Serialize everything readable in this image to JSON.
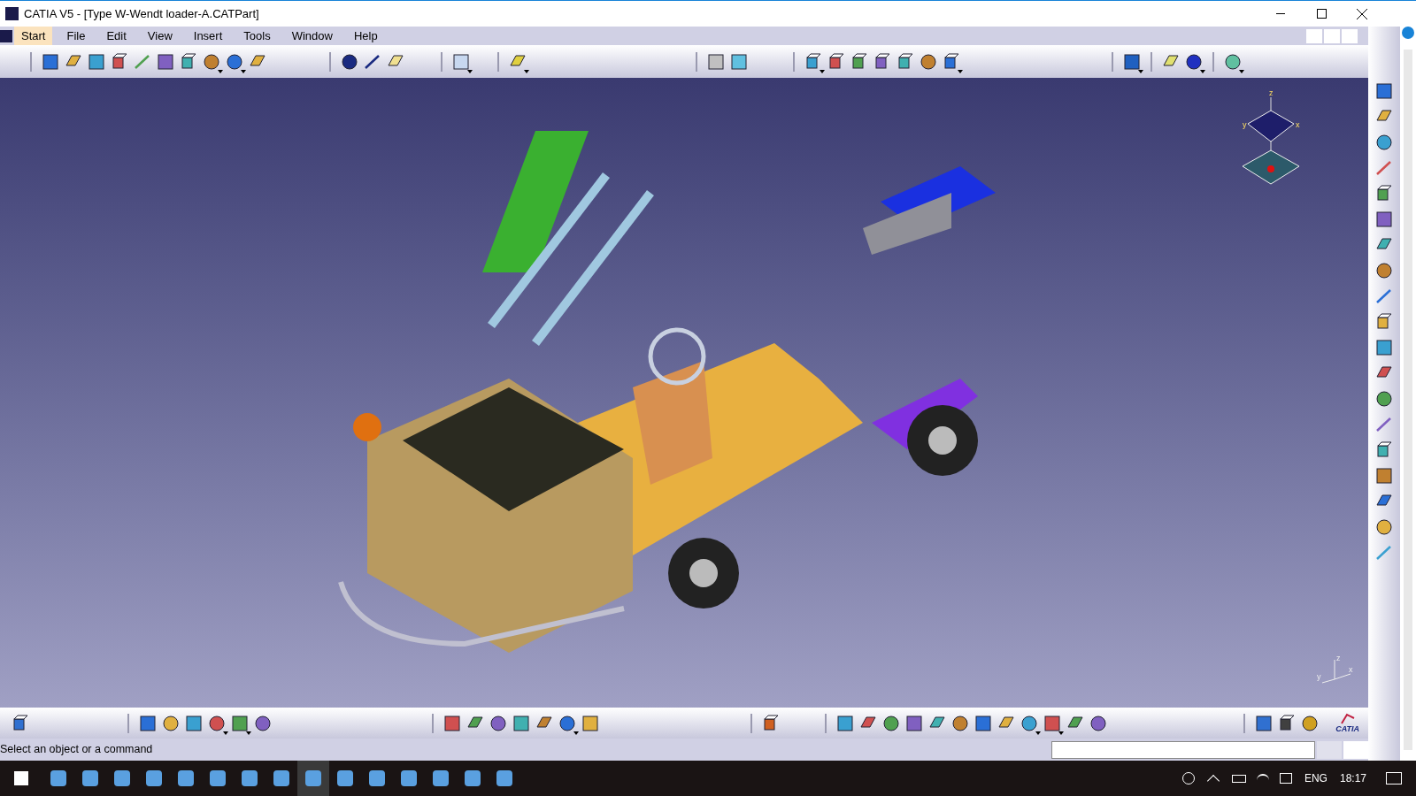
{
  "window": {
    "title": "CATIA V5 - [Type W-Wendt loader-A.CATPart]"
  },
  "menu": [
    {
      "label": "Start",
      "selected": true
    },
    {
      "label": "File",
      "selected": false
    },
    {
      "label": "Edit",
      "selected": false
    },
    {
      "label": "View",
      "selected": false
    },
    {
      "label": "Insert",
      "selected": false
    },
    {
      "label": "Tools",
      "selected": false
    },
    {
      "label": "Window",
      "selected": false
    },
    {
      "label": "Help",
      "selected": false
    }
  ],
  "compass": {
    "z": "z",
    "x": "x",
    "y": "y"
  },
  "axis_triad": {
    "z": "z",
    "x": "x",
    "y": "y"
  },
  "logo": {
    "text": "CATIA"
  },
  "status_bar": {
    "message": "Select an object or a command"
  },
  "taskbar": {
    "language": "ENG",
    "time": "18:17"
  }
}
